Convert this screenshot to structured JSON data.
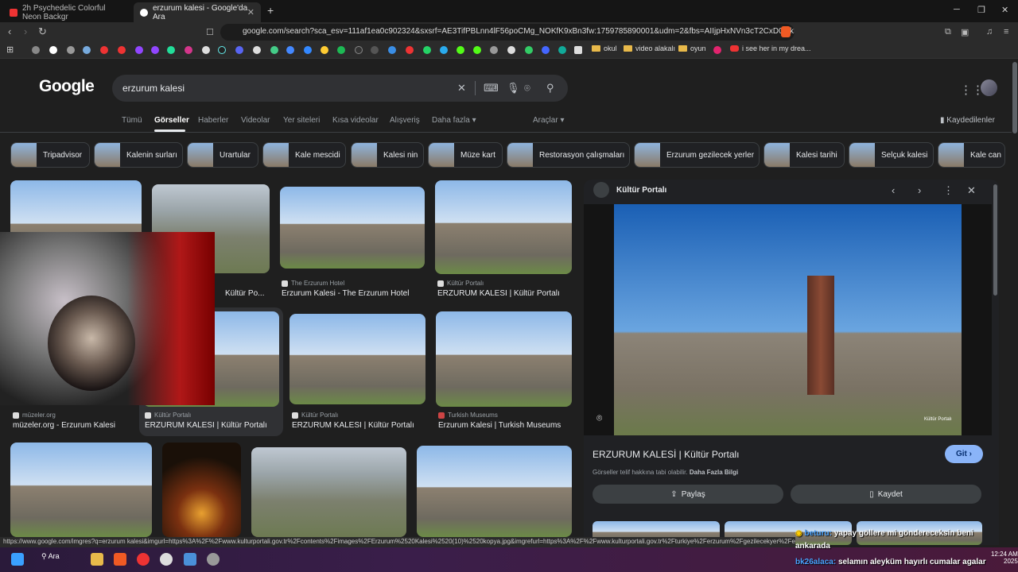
{
  "browser": {
    "tabs": [
      {
        "label": "2h Psychedelic Colorful Neon Backgr",
        "active": false
      },
      {
        "label": "erzurum kalesi - Google'da Ara",
        "active": true
      }
    ],
    "new_tab": "+",
    "url": "google.com/search?sca_esv=111af1ea0c902324&sxsrf=AE3TifPBLnn4lF56poCMg_NOKfK9xBn3fw:1759785890001&udm=2&fbs=AIIjpHxNVn3cT2CxD0Mkfrdhl...",
    "bookmarks": [
      {
        "label": "okul"
      },
      {
        "label": "video alakalı"
      },
      {
        "label": "oyun"
      },
      {
        "label": "i see her in my drea..."
      }
    ]
  },
  "google": {
    "logo": "Google",
    "query": "erzurum kalesi",
    "tabs": [
      "Tümü",
      "Görseller",
      "Haberler",
      "Videolar",
      "Yer siteleri",
      "Kısa videolar",
      "Alışveriş",
      "Daha fazla"
    ],
    "tools": "Araçlar",
    "saved": "Kaydedilenler",
    "chips": [
      "Tripadvisor",
      "Kalenin surları",
      "Urartular",
      "Kale mescidi",
      "Kalesi nin",
      "Müze kart",
      "Restorasyon çalışmaları",
      "Erzurum gezilecek yerler",
      "Kalesi tarihi",
      "Selçuk kalesi",
      "Kale can"
    ]
  },
  "results": [
    {
      "source": "",
      "title": "Kültür Po..."
    },
    {
      "source": "The Erzurum Hotel",
      "title": "Erzurum Kalesi - The Erzurum Hotel"
    },
    {
      "source": "Kültür Portalı",
      "title": "ERZURUM KALESİ | Kültür Portalı"
    },
    {
      "source": "müzeler.org",
      "title": "müzeler.org - Erzurum Kalesi"
    },
    {
      "source": "Kültür Portalı",
      "title": "ERZURUM KALESİ | Kültür Portalı"
    },
    {
      "source": "Kültür Portalı",
      "title": "ERZURUM KALESİ | Kültür Portalı"
    },
    {
      "source": "Turkish Museums",
      "title": "Erzurum Kalesi | Turkish Museums"
    }
  ],
  "panel": {
    "source": "Kültür Portalı",
    "title": "ERZURUM KALESİ | Kültür Portalı",
    "go": "Git",
    "copyright": "Görseller telif hakkına tabi olabilir.",
    "learn_more": "Daha Fazla Bilgi",
    "share": "Paylaş",
    "save": "Kaydet",
    "watermark": "Kültür Portalı"
  },
  "status_url": "https://www.google.com/imgres?q=erzurum kalesi&imgurl=https%3A%2F%2Fwww.kulturportali.gov.tr%2Fcontents%2Fimages%2FErzurum%2520Kalesi%2520(10)%2520kopya.jpg&imgrefurl=https%3A%2F%2Fwww.kulturportali.gov.tr%2Fturkiye%2Ferzurum%2Fgezilecekyer%2Ferzurum-kalesi&docid=oFOdhXwFqe_pPM&tbnid=ElpqcDhPeNw7aM&vet...",
  "taskbar": {
    "search": "Ara",
    "time": "12:24 AM",
    "date": "2025"
  },
  "chat": [
    {
      "user": "beturu:",
      "text": "yapay göllere mi göndereceksin beni"
    },
    {
      "user": "",
      "text": "ankarada"
    },
    {
      "user": "bk26alaca:",
      "text": "selamın aleyküm hayırlı cumalar agalar"
    }
  ]
}
